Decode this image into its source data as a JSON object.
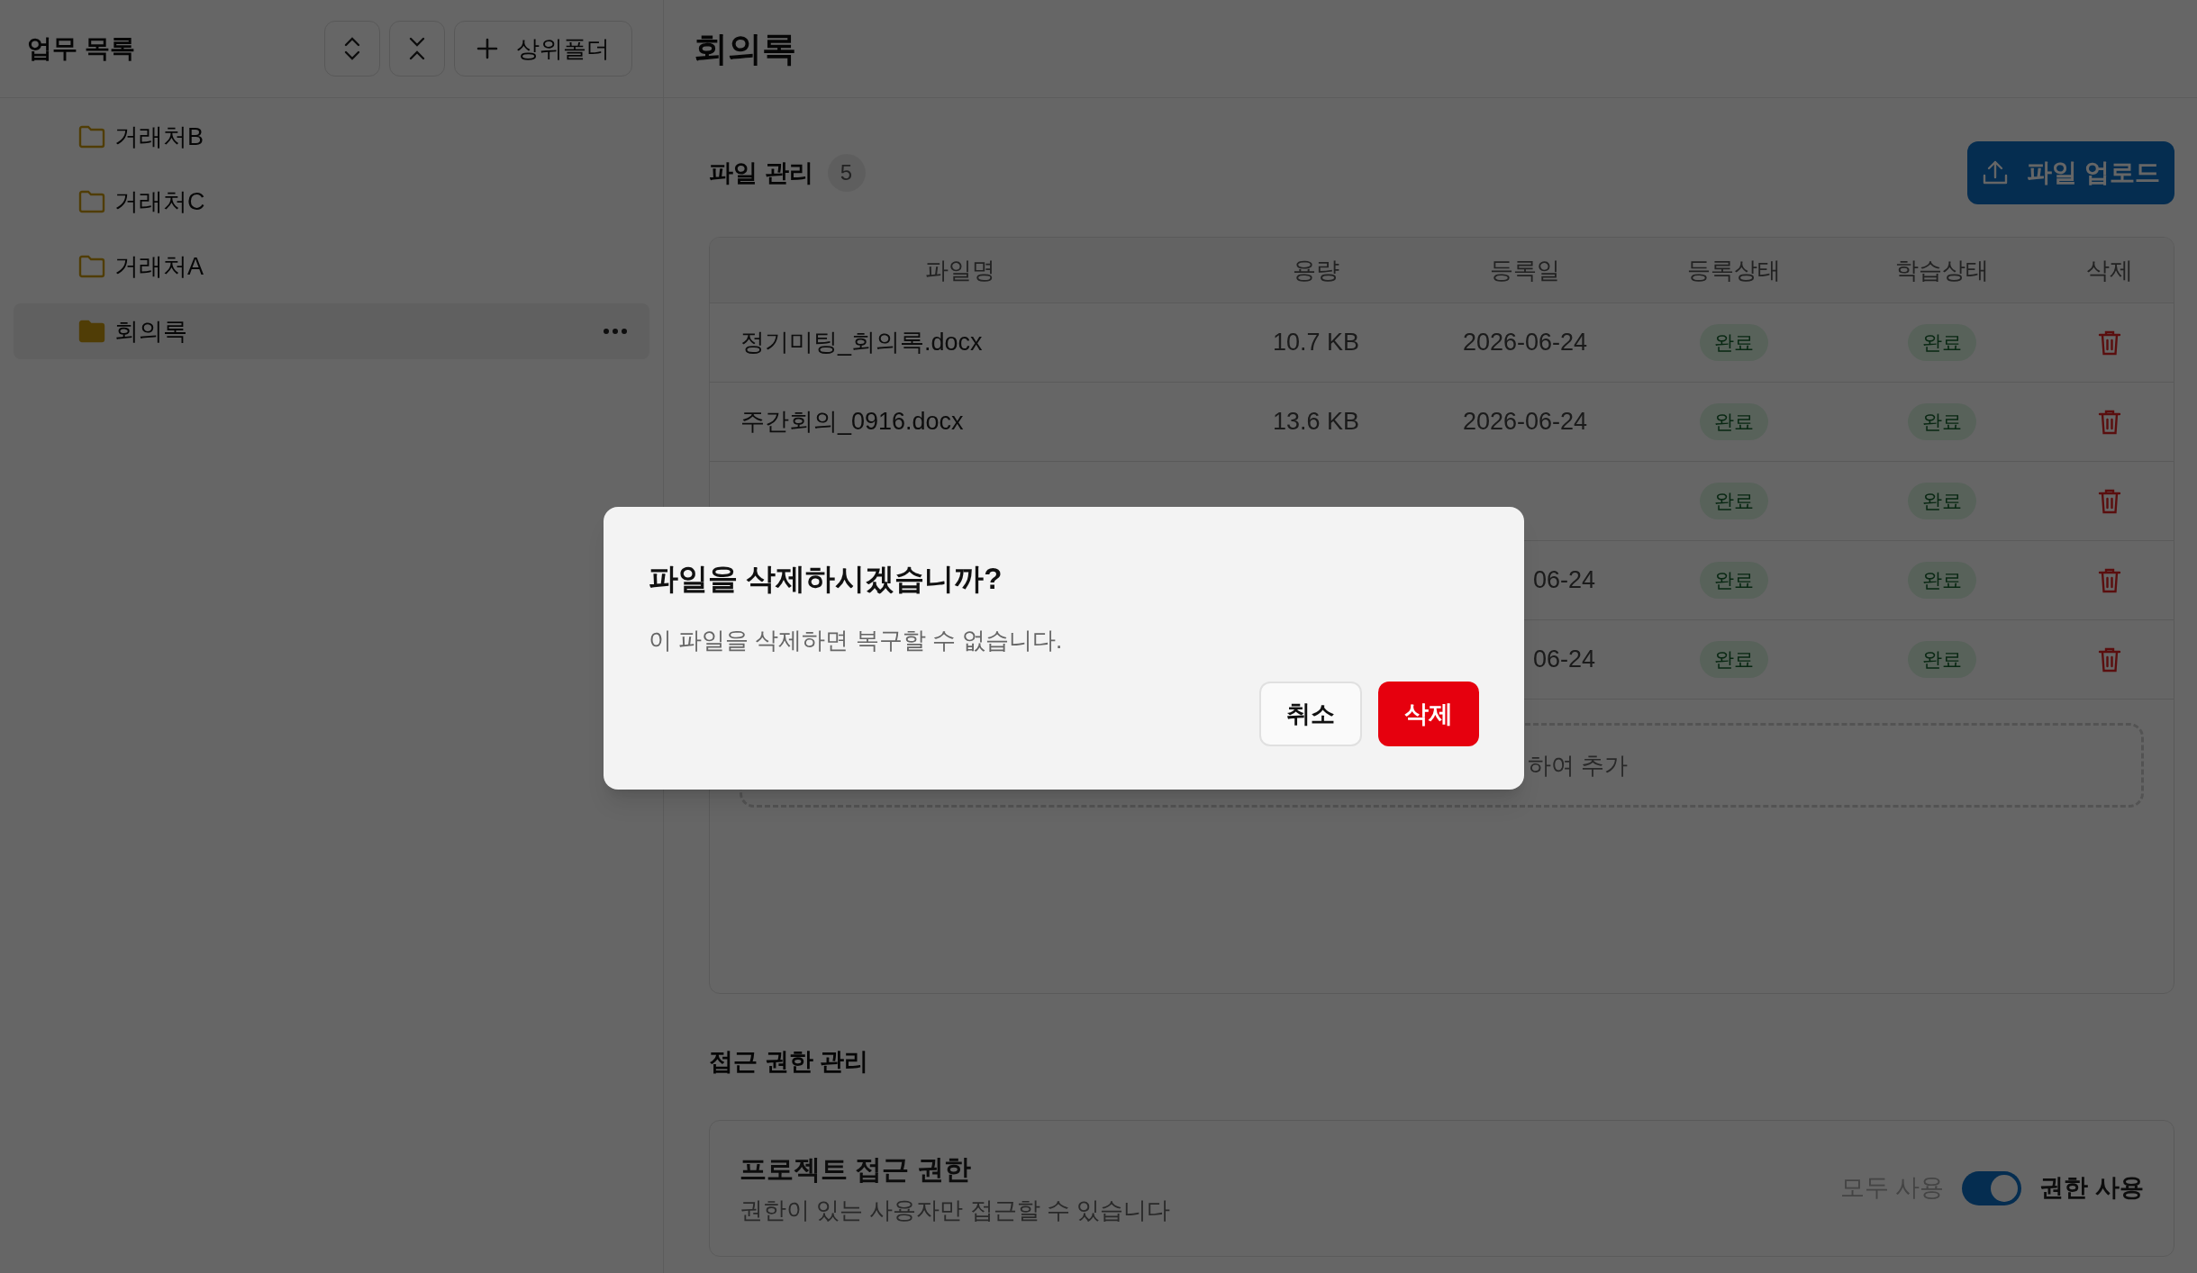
{
  "sidebar": {
    "title": "업무 목록",
    "add_folder_button": "상위폴더",
    "tree": [
      {
        "label": "거래처B",
        "selected": false
      },
      {
        "label": "거래처C",
        "selected": false
      },
      {
        "label": "거래처A",
        "selected": false
      },
      {
        "label": "회의록",
        "selected": true
      }
    ]
  },
  "page_title": "회의록",
  "files": {
    "title": "파일 관리",
    "count": "5",
    "upload_button": "파일 업로드",
    "columns": [
      "파일명",
      "용량",
      "등록일",
      "등록상태",
      "학습상태",
      "삭제"
    ],
    "rows": [
      {
        "name": "정기미팅_회의록.docx",
        "size": "10.7 KB",
        "date": "2026-06-24",
        "registration": "완료",
        "learning": "완료"
      },
      {
        "name": "주간회의_0916.docx",
        "size": "13.6 KB",
        "date": "2026-06-24",
        "registration": "완료",
        "learning": "완료"
      },
      {
        "registration": "완료",
        "learning": "완료"
      },
      {
        "date": "06-24",
        "registration": "완료",
        "learning": "완료"
      },
      {
        "date": "06-24",
        "registration": "완료",
        "learning": "완료"
      }
    ],
    "dropzone_text": "하여 추가"
  },
  "access": {
    "title": "접근 권한 관리",
    "card_title": "프로젝트 접근 권한",
    "description": "권한이 있는 사용자만 접근할 수 있습니다",
    "off_label": "모두 사용",
    "on_label": "권한 사용",
    "on": true
  },
  "dialog": {
    "title": "파일을 삭제하시겠습니까?",
    "message": "이 파일을 삭제하면 복구할 수 없습니다.",
    "cancel": "취소",
    "confirm": "삭제"
  }
}
